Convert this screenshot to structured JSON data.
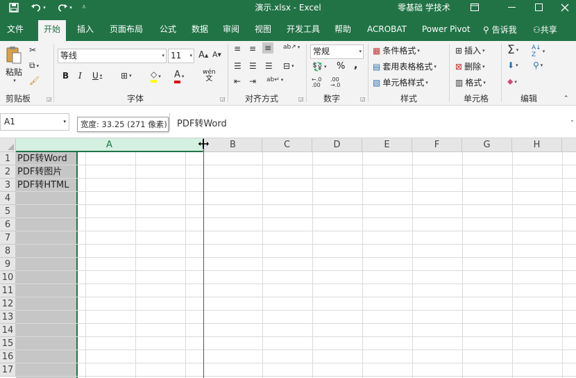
{
  "titlebar": {
    "title": "演示.xlsx  -  Excel",
    "user": "零基础 学技术",
    "save_icon": "save-icon",
    "undo_icon": "undo-icon",
    "redo_icon": "redo-icon"
  },
  "tabs": [
    {
      "label": "文件"
    },
    {
      "label": "开始"
    },
    {
      "label": "插入"
    },
    {
      "label": "页面布局"
    },
    {
      "label": "公式"
    },
    {
      "label": "数据"
    },
    {
      "label": "审阅"
    },
    {
      "label": "视图"
    },
    {
      "label": "开发工具"
    },
    {
      "label": "帮助"
    },
    {
      "label": "ACROBAT"
    },
    {
      "label": "Power Pivot"
    }
  ],
  "tell_me": "告诉我",
  "share": "共享",
  "ribbon": {
    "clipboard": {
      "paste": "粘贴",
      "label": "剪贴板"
    },
    "font": {
      "name": "等线",
      "size": "11",
      "bold": "B",
      "italic": "I",
      "underline": "U",
      "label": "字体",
      "phonetic": "wén"
    },
    "alignment": {
      "label": "对齐方式"
    },
    "number": {
      "format": "常规",
      "percent": "%",
      "comma": ",",
      "label": "数字"
    },
    "styles": {
      "conditional": "条件格式",
      "table": "套用表格格式",
      "cell": "单元格样式",
      "label": "样式"
    },
    "cells": {
      "insert": "插入",
      "delete": "删除",
      "format": "格式",
      "label": "单元格"
    },
    "editing": {
      "label": "编辑"
    }
  },
  "formula_bar": {
    "name_box": "A1",
    "formula": "PDF转Word",
    "tooltip": "宽度: 33.25 (271 像素)"
  },
  "grid": {
    "columns": [
      "A",
      "B",
      "C",
      "D",
      "E",
      "F",
      "G",
      "H"
    ],
    "rows": [
      "1",
      "2",
      "3",
      "4",
      "5",
      "6",
      "7",
      "8",
      "9",
      "10",
      "11",
      "12",
      "13",
      "14",
      "15",
      "16",
      "17"
    ],
    "cells": [
      "PDF转Word",
      "PDF转图片",
      "PDF转HTML"
    ]
  },
  "colors": {
    "accent": "#217346",
    "selected_column": "#c6c6c6",
    "header_bg": "#e6e6e6"
  }
}
